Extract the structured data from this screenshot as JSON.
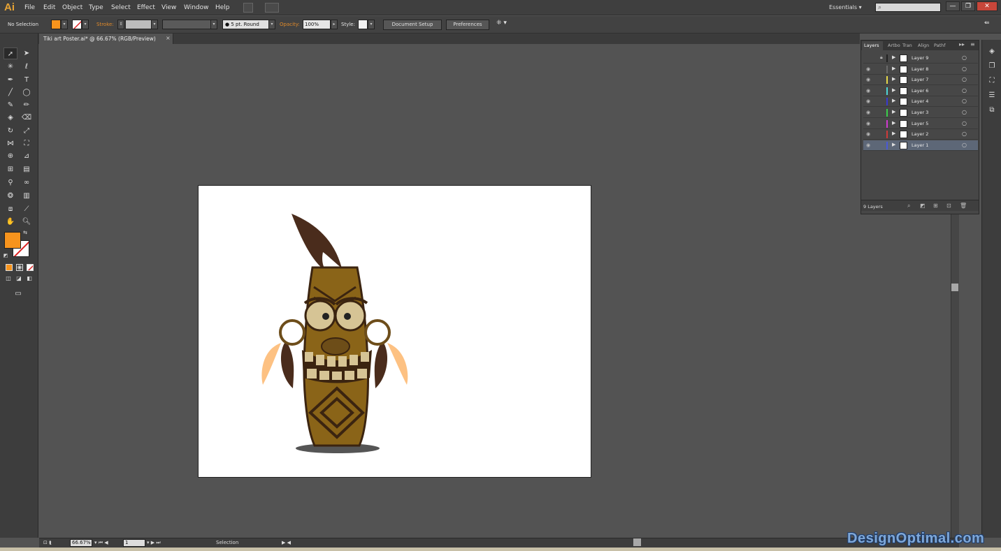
{
  "app": {
    "logo": "Ai"
  },
  "menus": [
    "File",
    "Edit",
    "Object",
    "Type",
    "Select",
    "Effect",
    "View",
    "Window",
    "Help"
  ],
  "workspace": {
    "label": "Essentials",
    "search_placeholder": ""
  },
  "window_controls": {
    "minimize": "—",
    "restore": "❐",
    "close": "✕"
  },
  "control_bar": {
    "selection_status": "No Selection",
    "stroke_label": "Stroke:",
    "brush": "5 pt. Round",
    "opacity_label": "Opacity:",
    "opacity_value": "100%",
    "style_label": "Style:",
    "document_setup": "Document Setup",
    "preferences": "Preferences",
    "fill_color": "#f7941d"
  },
  "document": {
    "tab_title": "Tiki art Poster.ai* @ 66.67% (RGB/Preview)",
    "close": "×"
  },
  "tools": {
    "fill_color": "#f7941d",
    "stroke_color": "#ffffff"
  },
  "layers_panel": {
    "tabs": [
      "Layers",
      "Artbo",
      "Tran",
      "Align",
      "Pathf"
    ],
    "layers": [
      {
        "name": "Layer 9",
        "color": "#222222",
        "visible": false,
        "locked": true,
        "selected": false
      },
      {
        "name": "Layer 8",
        "color": "#6b6b6b",
        "visible": true,
        "locked": false,
        "selected": false
      },
      {
        "name": "Layer 7",
        "color": "#e6d84a",
        "visible": true,
        "locked": false,
        "selected": false
      },
      {
        "name": "Layer 6",
        "color": "#4fd6d6",
        "visible": true,
        "locked": false,
        "selected": false
      },
      {
        "name": "Layer 4",
        "color": "#3a3ad0",
        "visible": true,
        "locked": false,
        "selected": false
      },
      {
        "name": "Layer 3",
        "color": "#3ad04a",
        "visible": true,
        "locked": false,
        "selected": false
      },
      {
        "name": "Layer 5",
        "color": "#d03ad0",
        "visible": true,
        "locked": false,
        "selected": false
      },
      {
        "name": "Layer 2",
        "color": "#d03a3a",
        "visible": true,
        "locked": false,
        "selected": false
      },
      {
        "name": "Layer 1",
        "color": "#4a5ad8",
        "visible": true,
        "locked": false,
        "selected": true
      }
    ],
    "count": "9 Layers"
  },
  "status_bar": {
    "zoom": "66.67%",
    "artboard_number": "1",
    "status": "Selection"
  },
  "watermark": "DesignOptimal.com"
}
